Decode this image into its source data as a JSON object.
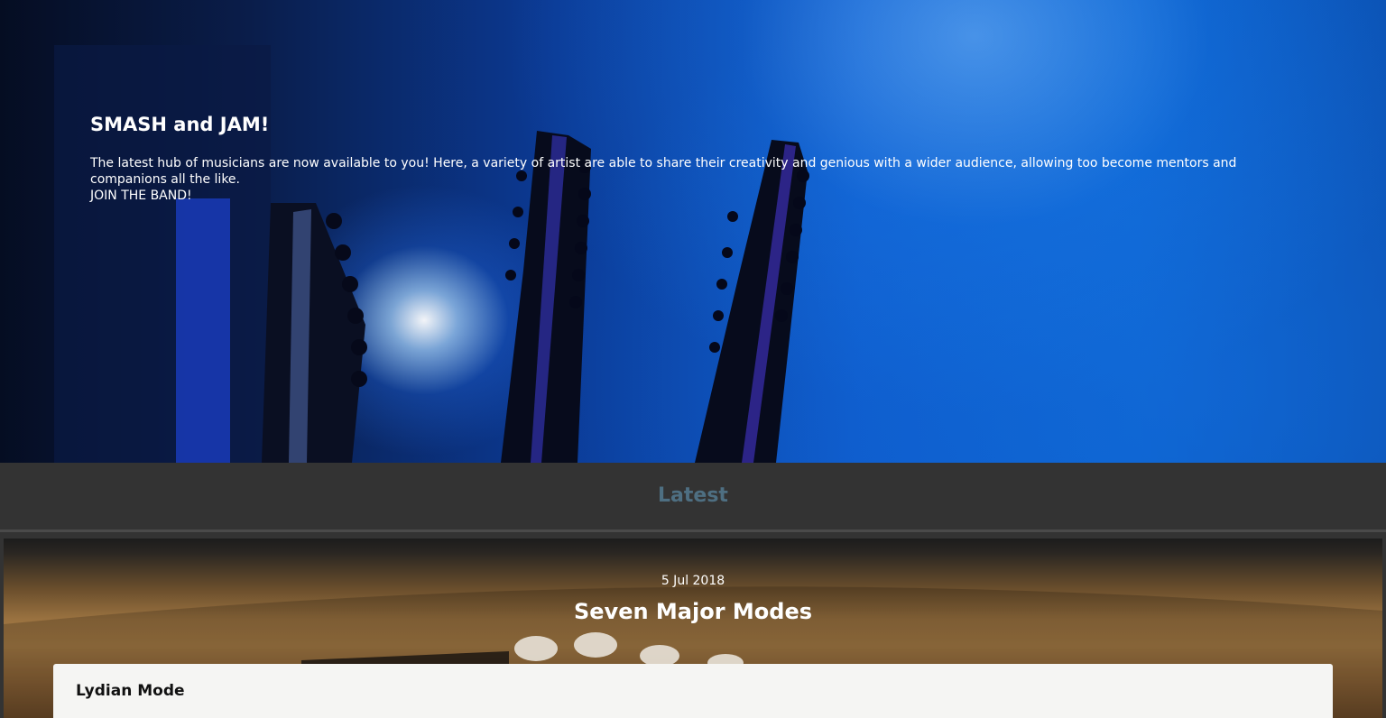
{
  "hero": {
    "title": "SMASH and JAM!",
    "text": "The latest hub of musicians are now available to you! Here, a variety of artist are able to share their creativity and genious with a wider audience, allowing too become mentors and companions all the like.",
    "cta": "JOIN THE BAND!",
    "image_description": "guitar-headstocks-blue-stage-light"
  },
  "latest": {
    "title": "Latest"
  },
  "post": {
    "date": "5 Jul 2018",
    "title": "Seven Major Modes",
    "section_title": "Lydian Mode",
    "image_description": "guitar-bridge-closeup"
  },
  "colors": {
    "hero_accent": "#0d58c9",
    "section_bg": "#333333",
    "latest_title": "#4e6f82",
    "card_bg": "#f5f5f3"
  }
}
